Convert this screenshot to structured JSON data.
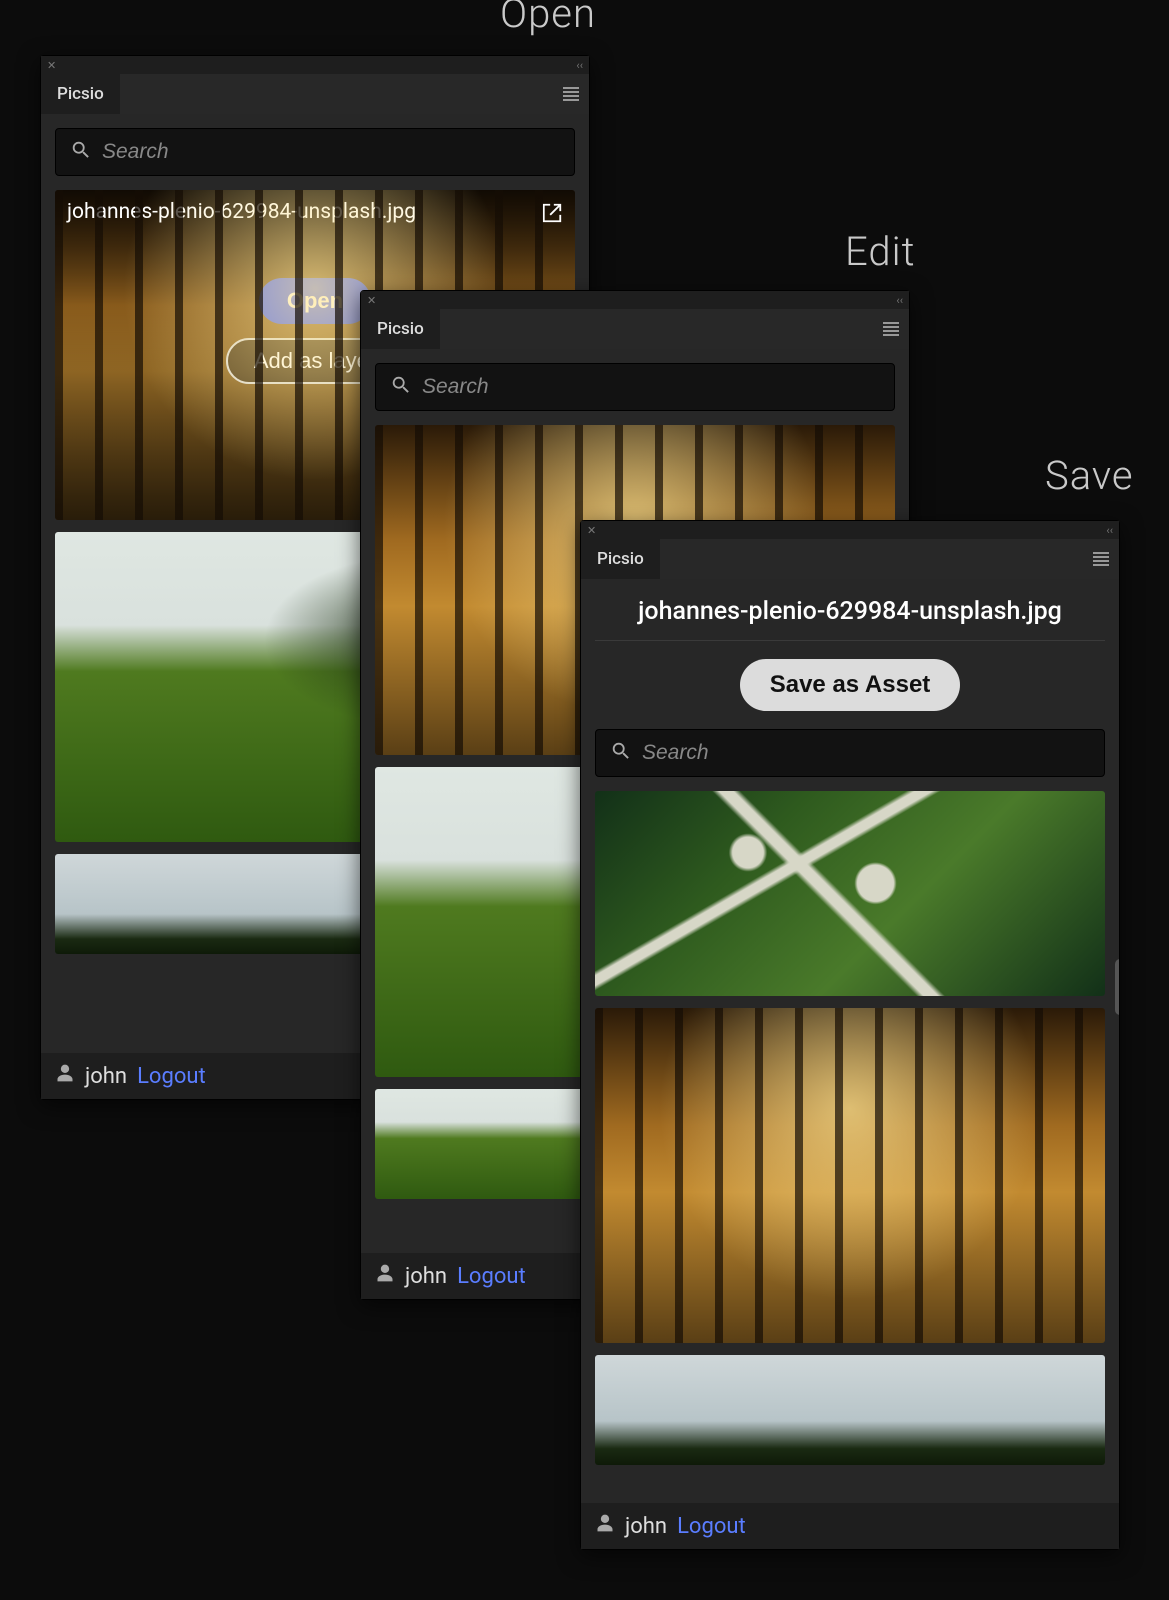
{
  "headings": {
    "open": "Open",
    "edit": "Edit",
    "save": "Save"
  },
  "app_tab": "Picsio",
  "search_placeholder": "Search",
  "open_panel": {
    "filename": "johannes-plenio-629984-unsplash.jpg",
    "open_btn": "Open",
    "add_layer_btn": "Add as layer"
  },
  "save_panel": {
    "filename": "johannes-plenio-629984-unsplash.jpg",
    "save_btn": "Save as Asset"
  },
  "footer": {
    "username": "john",
    "logout": "Logout"
  }
}
